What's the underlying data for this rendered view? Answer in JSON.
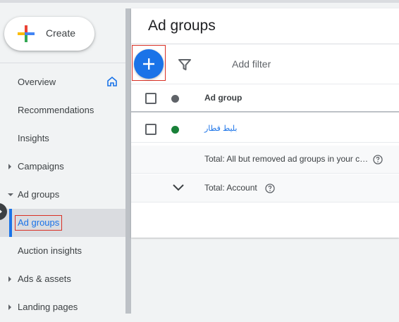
{
  "sidebar": {
    "create_label": "Create",
    "items": [
      {
        "label": "Overview"
      },
      {
        "label": "Recommendations"
      },
      {
        "label": "Insights"
      },
      {
        "label": "Campaigns"
      },
      {
        "label": "Ad groups"
      },
      {
        "label": "Ad groups"
      },
      {
        "label": "Auction insights"
      },
      {
        "label": "Ads & assets"
      },
      {
        "label": "Landing pages"
      }
    ]
  },
  "main": {
    "title": "Ad groups",
    "add_filter_label": "Add filter",
    "column_header": "Ad group",
    "rows": [
      {
        "name": "بليط قطار",
        "status_color": "#188038"
      }
    ],
    "totals": [
      {
        "label": "Total: All but removed ad groups in your c…"
      },
      {
        "label": "Total: Account"
      }
    ]
  },
  "colors": {
    "accent": "#1a73e8",
    "highlight_box": "#d93025",
    "enabled": "#188038",
    "header_dot": "#5f6368"
  },
  "icons": [
    "google-plus-icon",
    "home-icon",
    "caret-right-icon",
    "caret-down-icon",
    "add-icon",
    "filter-icon",
    "help-icon",
    "chevron-down-icon",
    "collapse-arrow-icon"
  ]
}
